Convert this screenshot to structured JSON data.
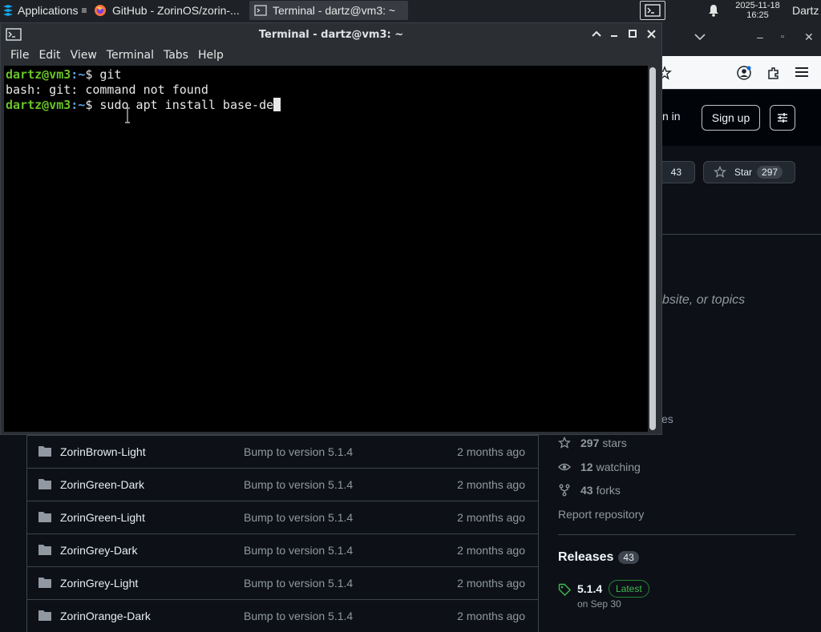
{
  "panel": {
    "applications_label": "Applications",
    "tasks": [
      {
        "label": "GitHub - ZorinOS/zorin-..."
      },
      {
        "label": "Terminal - dartz@vm3: ~"
      }
    ],
    "clock_date": "2025-11-18",
    "clock_time": "16:25",
    "user": "Dartz"
  },
  "terminal": {
    "title": "Terminal - dartz@vm3: ~",
    "menu": [
      "File",
      "Edit",
      "View",
      "Terminal",
      "Tabs",
      "Help"
    ],
    "lines": [
      {
        "user": "dartz@vm3",
        "path": ":~",
        "symbol": "$ ",
        "cmd": "git"
      },
      {
        "output": "bash: git: command not found"
      },
      {
        "user": "dartz@vm3",
        "path": ":~",
        "symbol": "$ ",
        "cmd": "sudo apt install base-de"
      }
    ]
  },
  "github": {
    "sign_in_partial": "n in",
    "sign_up": "Sign up",
    "fork_count": "43",
    "star_label": "Star",
    "star_count": "297",
    "about_partial": "bsite, or topics",
    "es_partial": "es",
    "files": [
      {
        "name": "ZorinBrown-Light",
        "message": "Bump to version 5.1.4",
        "date": "2 months ago"
      },
      {
        "name": "ZorinGreen-Dark",
        "message": "Bump to version 5.1.4",
        "date": "2 months ago"
      },
      {
        "name": "ZorinGreen-Light",
        "message": "Bump to version 5.1.4",
        "date": "2 months ago"
      },
      {
        "name": "ZorinGrey-Dark",
        "message": "Bump to version 5.1.4",
        "date": "2 months ago"
      },
      {
        "name": "ZorinGrey-Light",
        "message": "Bump to version 5.1.4",
        "date": "2 months ago"
      },
      {
        "name": "ZorinOrange-Dark",
        "message": "Bump to version 5.1.4",
        "date": "2 months ago"
      }
    ],
    "stats": {
      "stars_count": "297",
      "stars_label": "stars",
      "watching_count": "12",
      "watching_label": "watching",
      "forks_count": "43",
      "forks_label": "forks"
    },
    "report": "Report repository",
    "releases_title": "Releases",
    "releases_count": "43",
    "release_version": "5.1.4",
    "release_badge": "Latest",
    "release_date": "on Sep 30"
  },
  "colors": {
    "terminal_bg": "#000000",
    "prompt_user": "#69c226",
    "prompt_path": "#5da4e8",
    "github_bg": "#0d1117"
  }
}
